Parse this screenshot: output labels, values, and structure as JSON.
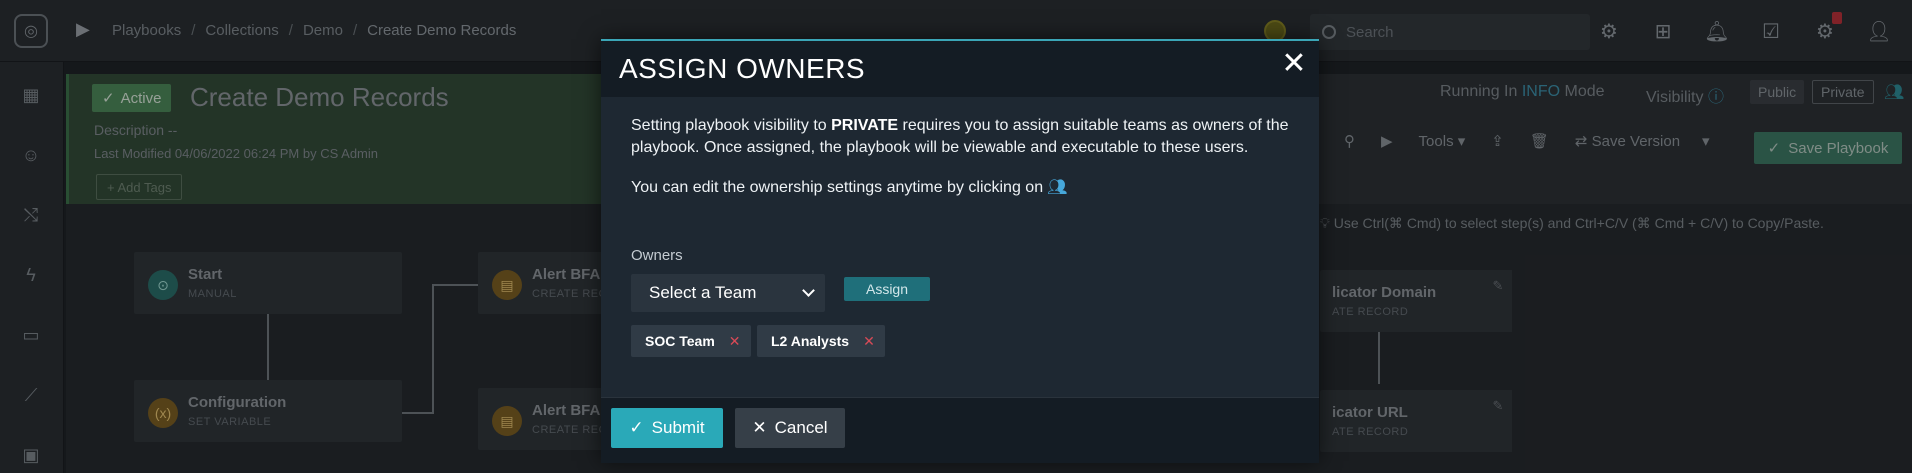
{
  "app": {
    "breadcrumb": [
      "Playbooks",
      "Collections",
      "Demo",
      "Create Demo Records"
    ],
    "search_placeholder": "Search"
  },
  "header": {
    "status": "Active",
    "title": "Create Demo Records",
    "description_label": "Description",
    "description_value": "--",
    "last_modified": "Last Modified 04/06/2022 06:24 PM by CS Admin",
    "add_tags": "+ Add Tags",
    "running_prefix": "Running In",
    "running_mode": "INFO",
    "running_suffix": "Mode",
    "visibility_label": "Visibility",
    "visibility_public": "Public",
    "visibility_private": "Private"
  },
  "toolbar": {
    "tools": "Tools",
    "save_version": "Save Version",
    "save_playbook": "Save Playbook",
    "hint": "Use Ctrl(⌘ Cmd) to select step(s) and Ctrl+C/V (⌘ Cmd + C/V) to Copy/Paste."
  },
  "canvas": {
    "nodes": [
      {
        "title": "Start",
        "subtitle": "MANUAL"
      },
      {
        "title": "Configuration",
        "subtitle": "SET VARIABLE"
      },
      {
        "title": "Alert BFA",
        "subtitle": "CREATE RECO"
      },
      {
        "title": "Alert BFA",
        "subtitle": "CREATE RECO"
      },
      {
        "title": "licator Domain",
        "subtitle": "ATE RECORD"
      },
      {
        "title": "icator URL",
        "subtitle": "ATE RECORD"
      }
    ]
  },
  "modal": {
    "title": "ASSIGN OWNERS",
    "body_pre": "Setting playbook visibility to ",
    "body_bold": "PRIVATE",
    "body_post": " requires you to assign suitable teams as owners of the playbook. Once assigned, the playbook will be viewable and executable to these users.",
    "edit_note": "You can edit the ownership settings anytime by clicking on",
    "owners_label": "Owners",
    "select_placeholder": "Select a Team",
    "assign_label": "Assign",
    "tags": [
      "SOC Team",
      "L2 Analysts"
    ],
    "submit_label": "Submit",
    "cancel_label": "Cancel"
  },
  "icons": {
    "close": "close-icon",
    "team": "team-icon",
    "check": "check-icon",
    "remove": "remove-tag-icon"
  },
  "colors": {
    "accent": "#2aa9b8",
    "modal_bg": "#1e2832",
    "tag_remove": "#d84a57",
    "active_green": "#4d8759"
  }
}
